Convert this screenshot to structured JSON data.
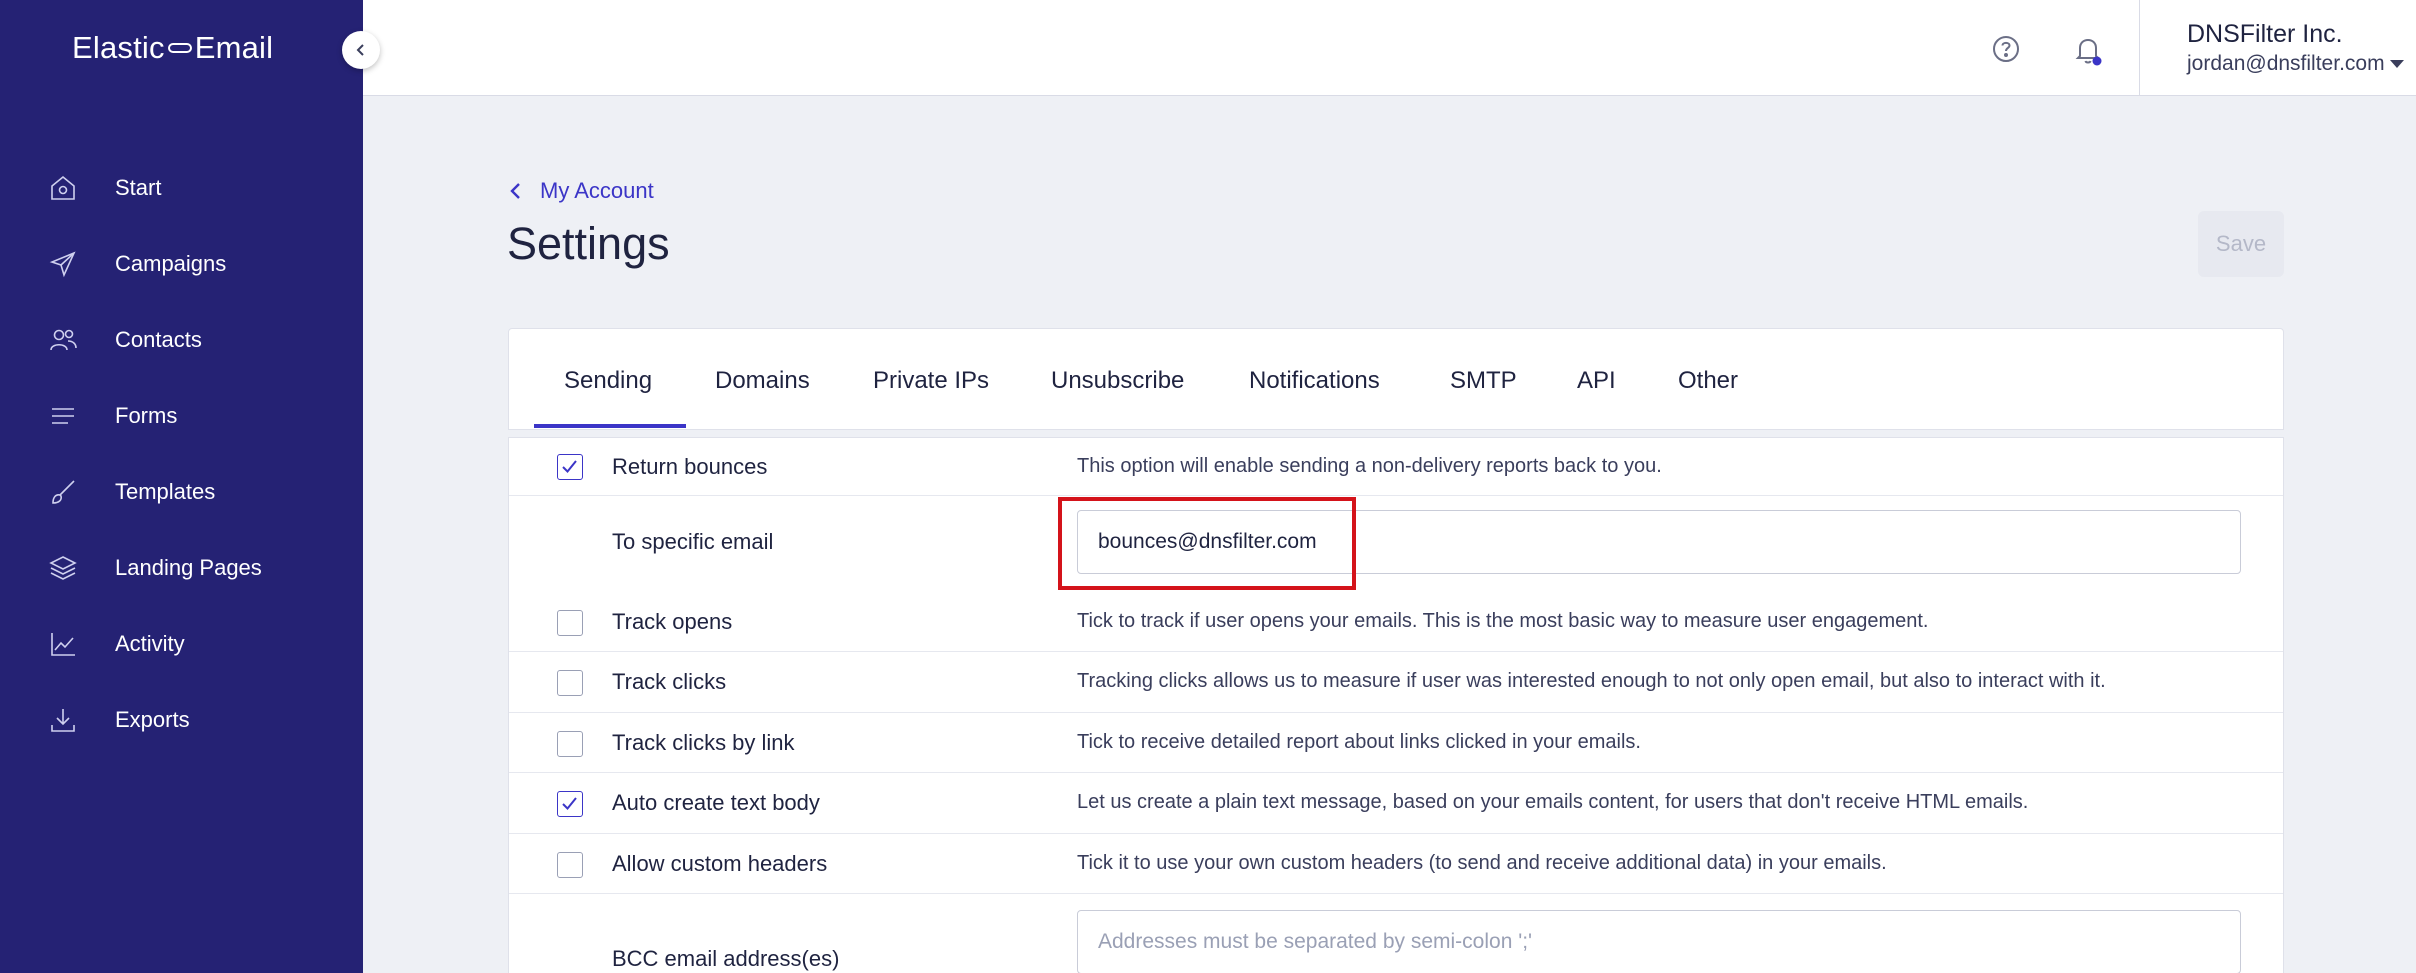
{
  "brand": {
    "left": "Elastic",
    "right": "Email"
  },
  "sidebar": {
    "items": [
      {
        "label": "Start",
        "icon": "home-icon"
      },
      {
        "label": "Campaigns",
        "icon": "paper-plane-icon"
      },
      {
        "label": "Contacts",
        "icon": "users-icon"
      },
      {
        "label": "Forms",
        "icon": "lines-icon"
      },
      {
        "label": "Templates",
        "icon": "brush-icon"
      },
      {
        "label": "Landing Pages",
        "icon": "layers-icon"
      },
      {
        "label": "Activity",
        "icon": "chart-icon"
      },
      {
        "label": "Exports",
        "icon": "download-icon"
      }
    ]
  },
  "header": {
    "org_name": "DNSFilter Inc.",
    "user_email": "jordan@dnsfilter.com"
  },
  "page": {
    "back_label": "My Account",
    "title": "Settings",
    "save_label": "Save"
  },
  "tabs": [
    {
      "label": "Sending",
      "active": true
    },
    {
      "label": "Domains"
    },
    {
      "label": "Private IPs"
    },
    {
      "label": "Unsubscribe"
    },
    {
      "label": "Notifications"
    },
    {
      "label": "SMTP"
    },
    {
      "label": "API"
    },
    {
      "label": "Other"
    }
  ],
  "settings": {
    "return_bounces": {
      "label": "Return bounces",
      "checked": true,
      "desc": "This option will enable sending a non-delivery reports back to you."
    },
    "specific_email": {
      "label": "To specific email",
      "value": "bounces@dnsfilter.com"
    },
    "track_opens": {
      "label": "Track opens",
      "checked": false,
      "desc": "Tick to track if user opens your emails. This is the most basic way to measure user engagement."
    },
    "track_clicks": {
      "label": "Track clicks",
      "checked": false,
      "desc": "Tracking clicks allows us to measure if user was interested enough to not only open email, but also to interact with it."
    },
    "track_clicks_link": {
      "label": "Track clicks by link",
      "checked": false,
      "desc": "Tick to receive detailed report about links clicked in your emails."
    },
    "auto_text": {
      "label": "Auto create text body",
      "checked": true,
      "desc": "Let us create a plain text message, based on your emails content, for users that don't receive HTML emails."
    },
    "custom_headers": {
      "label": "Allow custom headers",
      "checked": false,
      "desc": "Tick it to use your own custom headers (to send and receive additional data) in your emails."
    },
    "bcc": {
      "label": "BCC email address(es)",
      "placeholder": "Addresses must be separated by semi-colon ';'"
    }
  },
  "colors": {
    "sidebar": "#252274",
    "accent": "#3b35c7",
    "highlight": "#d4131a"
  }
}
